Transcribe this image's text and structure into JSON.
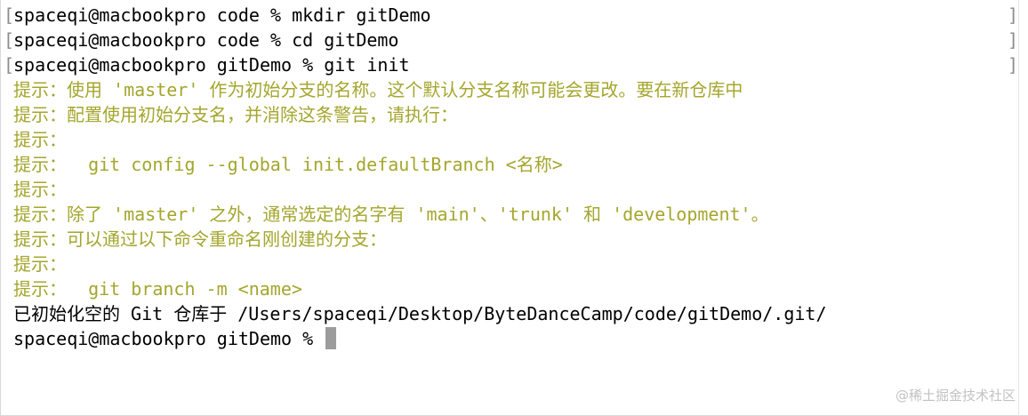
{
  "terminal": {
    "lines": [
      "spaceqi@macbookpro code % mkdir gitDemo",
      "spaceqi@macbookpro code % cd gitDemo",
      "spaceqi@macbookpro gitDemo % git init",
      "提示：使用 'master' 作为初始分支的名称。这个默认分支名称可能会更改。要在新仓库中",
      "提示：配置使用初始分支名，并消除这条警告，请执行：",
      "提示：",
      "提示：  git config --global init.defaultBranch <名称>",
      "提示：",
      "提示：除了 'master' 之外，通常选定的名字有 'main'、'trunk' 和 'development'。",
      "提示：可以通过以下命令重命名刚创建的分支：",
      "提示：",
      "提示：  git branch -m <name>",
      "已初始化空的 Git 仓库于 /Users/spaceqi/Desktop/ByteDanceCamp/code/gitDemo/.git/",
      "spaceqi@macbookpro gitDemo % "
    ],
    "bracket_open": "[",
    "bracket_close": "]",
    "colors": {
      "text": "#000000",
      "hint": "#a4a62d",
      "cursor": "#9c9c9c"
    }
  },
  "watermark": "@稀土掘金技术社区"
}
